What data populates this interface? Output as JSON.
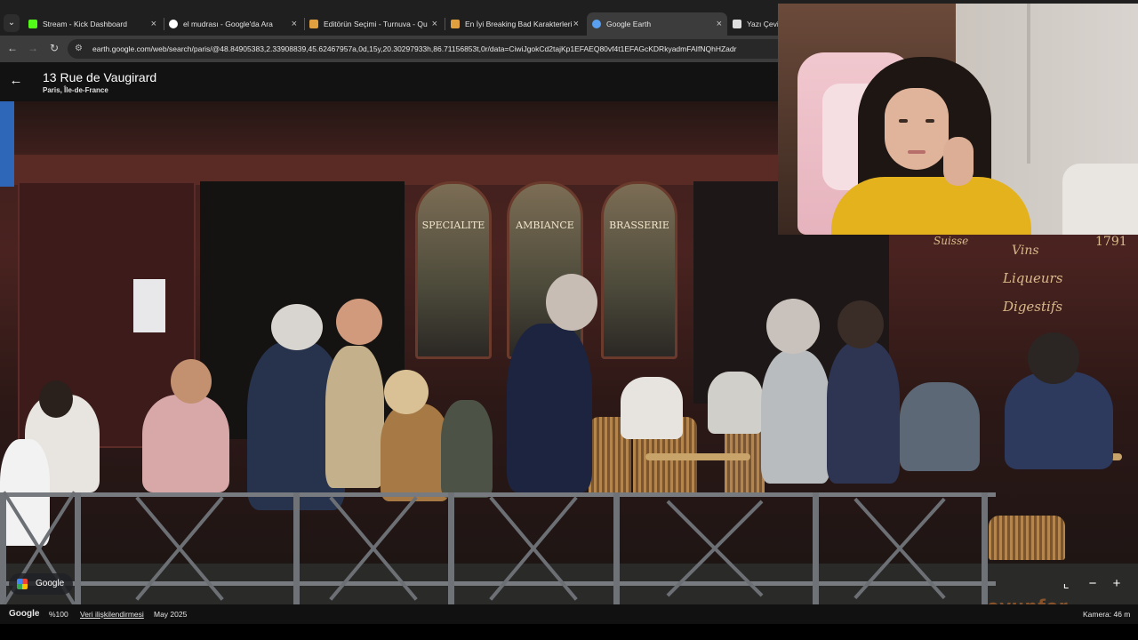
{
  "browser": {
    "tabs": [
      {
        "title": "Stream - Kick Dashboard",
        "favicon_color": "#53fc18"
      },
      {
        "title": "el mudrası - Google'da Ara",
        "favicon_color": "#ffffff"
      },
      {
        "title": "Editörün Seçimi - Turnuva - Qu",
        "favicon_color": "#e0a040"
      },
      {
        "title": "En İyi Breaking Bad Karakterleri",
        "favicon_color": "#e0a040"
      },
      {
        "title": "Google Earth",
        "favicon_color": "#5aa0f0",
        "active": true
      },
      {
        "title": "Yazı Çevir",
        "favicon_color": "#e0e0e0"
      }
    ],
    "address_bar": {
      "url": "earth.google.com/web/search/paris/@48.84905383,2.33908839,45.62467957a,0d,15y,20.30297933h,86.71156853t,0r/data=CiwiJgokCd2tajKp1EFAEQ80vf4t1EFAGcKDRkyadmFAIfNQhHZadr"
    }
  },
  "earth": {
    "place_title": "13 Rue de Vaugirard",
    "place_subtitle": "Paris, Île-de-France",
    "scene_signs": {
      "window_1": "SPECIALITE",
      "window_2": "AMBIANCE",
      "window_3": "BRASSERIE",
      "wall_right_1": "Vins",
      "wall_right_2": "Liqueurs",
      "wall_right_3": "Digestifs",
      "wall_right_number": "1791",
      "wall_top_right": "Suisse"
    },
    "google_chip_label": "Google",
    "zoom_in": "+",
    "zoom_out": "−",
    "status_bar": {
      "brand": "Google",
      "zoom": "%100",
      "data_attribution": "Veri ilişkilendirmesi",
      "date": "May 2025",
      "camera": "Kamera: 46 m"
    }
  },
  "overlay": {
    "watermark": "oyunfor"
  }
}
